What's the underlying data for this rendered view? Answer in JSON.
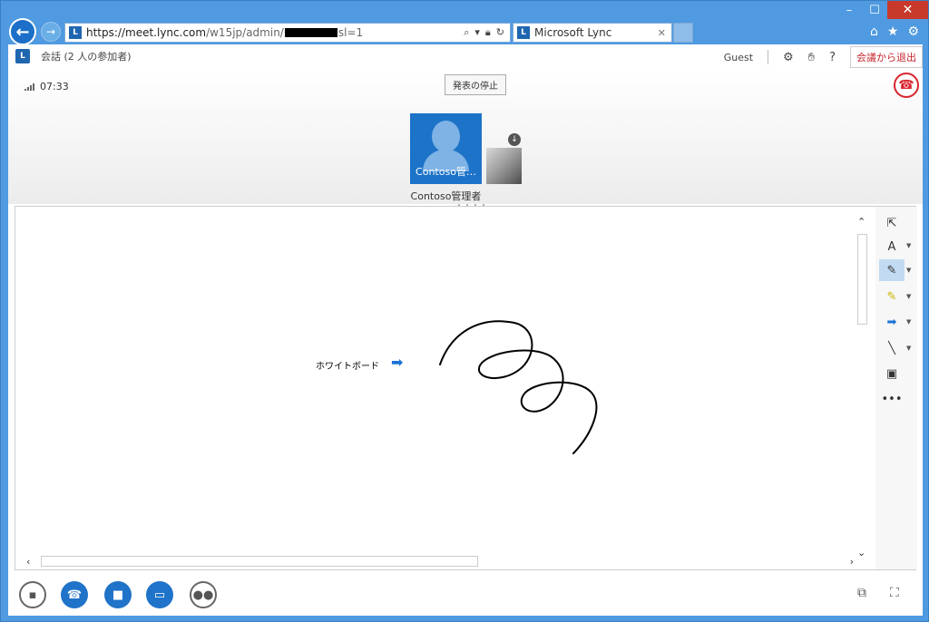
{
  "browser": {
    "url_host": "https://meet.lync.com",
    "url_path": "/w15jp/admin/",
    "url_suffix": "sl=1",
    "tab_title": "Microsoft Lync"
  },
  "app": {
    "conversation_title": "会話 (2 人の参加者)",
    "user": "Guest",
    "leave_button": "会議から退出",
    "timer": "07:33",
    "stop_presenting_button": "発表の停止",
    "participant_tile_label": "Contoso管…",
    "participant_name": "Contoso管理者",
    "participant_name_more": "・・・・"
  },
  "whiteboard": {
    "label": "ホワイトボード"
  },
  "colors": {
    "accent": "#1f73c8",
    "hangup": "#d8252f",
    "leave_text": "#c4262e",
    "window_frame": "#4f9ae0"
  },
  "icons": {
    "back": "arrow-left-icon",
    "forward": "arrow-right-icon",
    "search": "search-icon",
    "lock": "lock-icon",
    "refresh": "refresh-icon",
    "home": "home-icon",
    "favorites": "star-icon",
    "settings": "gear-icon",
    "hand": "hand-icon",
    "help": "help-icon",
    "hangup": "phone-hangup-icon"
  }
}
